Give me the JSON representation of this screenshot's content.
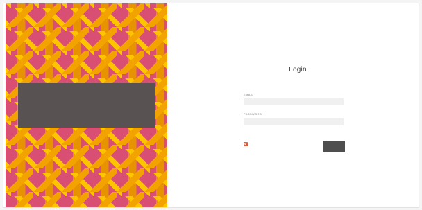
{
  "login": {
    "title": "Login",
    "email": {
      "label": "EMAIL",
      "value": "",
      "placeholder": ""
    },
    "password": {
      "label": "PASSWORD",
      "value": "",
      "placeholder": ""
    },
    "remember_checked": true,
    "submit_label": ""
  },
  "colors": {
    "hero_background": "#d94f73",
    "hero_tile_orange": "#f2a300",
    "hero_tile_yellow": "#ffc400",
    "hero_overlay": "#585252",
    "checkbox_accent": "#d95b3d",
    "submit_background": "#4e4e4e"
  },
  "icons": {
    "checkbox": "checkmark-icon"
  }
}
